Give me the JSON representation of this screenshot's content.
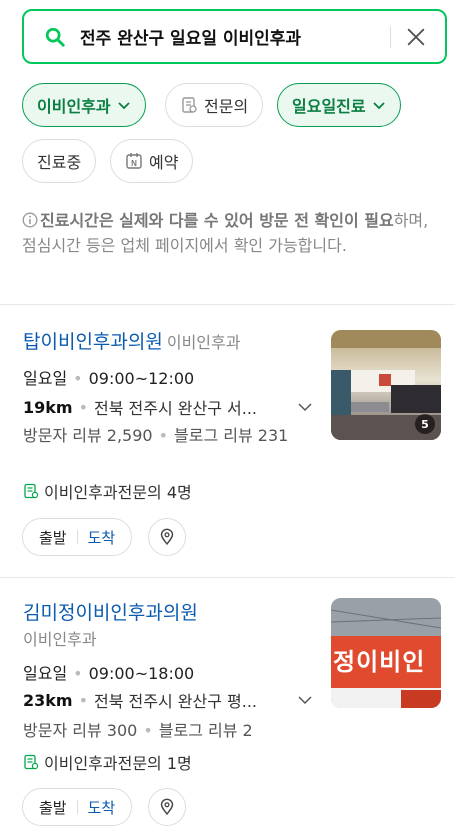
{
  "search": {
    "query": "전주 완산구 일요일 이비인후과"
  },
  "filters": {
    "row1": [
      {
        "label": "이비인후과",
        "active": true
      },
      {
        "label": "전문의",
        "active": false
      },
      {
        "label": "일요일진료",
        "active": true
      }
    ],
    "row2": [
      {
        "label": "진료중"
      },
      {
        "label": "예약"
      }
    ]
  },
  "notice": {
    "bold": "진료시간은 실제와 다를 수 있어 방문 전 확인이 필요",
    "rest": "하며, 점심시간 등은 업체 페이지에서 확인 가능합니다."
  },
  "results": [
    {
      "name": "탑이비인후과의원",
      "category": "이비인후과",
      "day": "일요일",
      "hours": "09:00~12:00",
      "distance": "19km",
      "address": "전북 전주시 완산구 서...",
      "reviews_visitor": "방문자 리뷰 2,590",
      "reviews_blog": "블로그 리뷰 231",
      "specialist": "이비인후과전문의 4명",
      "photo_count": "5",
      "depart": "출발",
      "arrive": "도착"
    },
    {
      "name": "김미정이비인후과의원",
      "category": "이비인후과",
      "day": "일요일",
      "hours": "09:00~18:00",
      "distance": "23km",
      "address": "전북 전주시 완산구 평...",
      "reviews_visitor": "방문자 리뷰 300",
      "reviews_blog": "블로그 리뷰 2",
      "specialist": "이비인후과전문의 1명",
      "sign_text": "정이비인",
      "depart": "출발",
      "arrive": "도착"
    }
  ],
  "colors": {
    "accent": "#03c75a",
    "link": "#0b5bb0"
  }
}
